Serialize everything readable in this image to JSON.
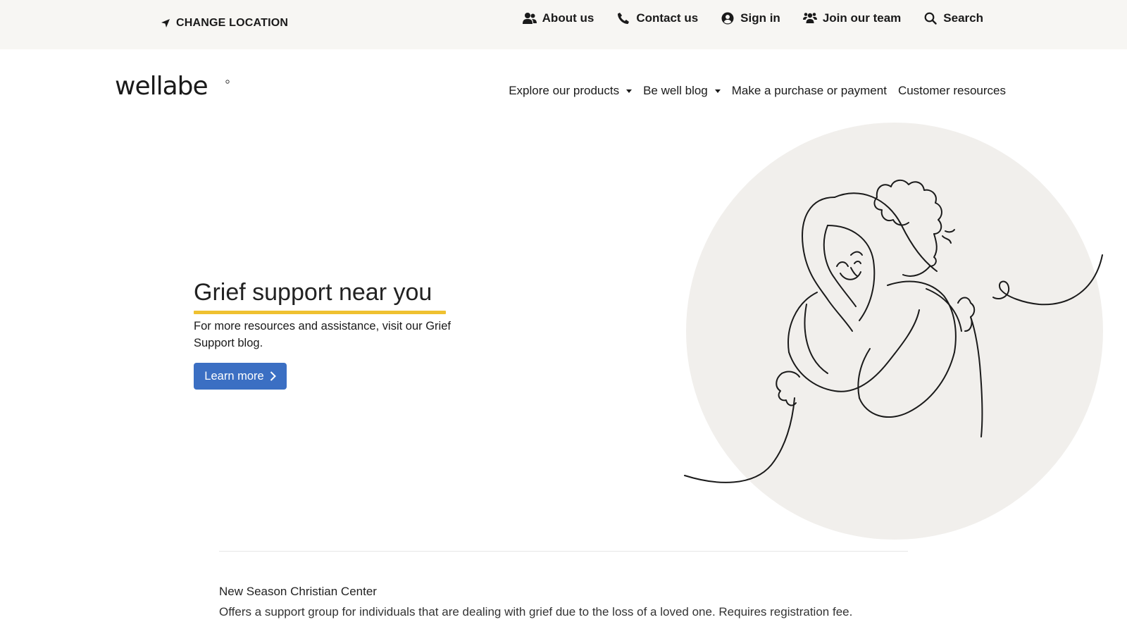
{
  "utility_bar": {
    "change_location": "CHANGE LOCATION",
    "links": [
      {
        "label": "About us",
        "icon": "users-icon"
      },
      {
        "label": "Contact us",
        "icon": "phone-icon"
      },
      {
        "label": "Sign in",
        "icon": "user-circle-icon"
      },
      {
        "label": "Join our team",
        "icon": "group-icon"
      },
      {
        "label": "Search",
        "icon": "search-icon"
      }
    ]
  },
  "brand": {
    "logo_text": "wellabe"
  },
  "main_nav": {
    "items": [
      {
        "label": "Explore our products",
        "dropdown": true
      },
      {
        "label": "Be well blog",
        "dropdown": true
      },
      {
        "label": "Make a purchase or payment",
        "dropdown": false
      },
      {
        "label": "Customer resources",
        "dropdown": false
      }
    ]
  },
  "hero": {
    "title": "Grief support near you",
    "description": "For more resources and assistance, visit our Grief Support blog.",
    "button_label": "Learn more"
  },
  "listing": {
    "name": "New Season Christian Center",
    "description": "Offers a support group for individuals that are dealing with grief due to the loss of a loved one. Requires registration fee."
  },
  "colors": {
    "utility_bar_bg": "#f7f6f3",
    "accent_yellow": "#efc130",
    "button_blue": "#3b6fc3",
    "circle_bg": "#f1efec"
  }
}
